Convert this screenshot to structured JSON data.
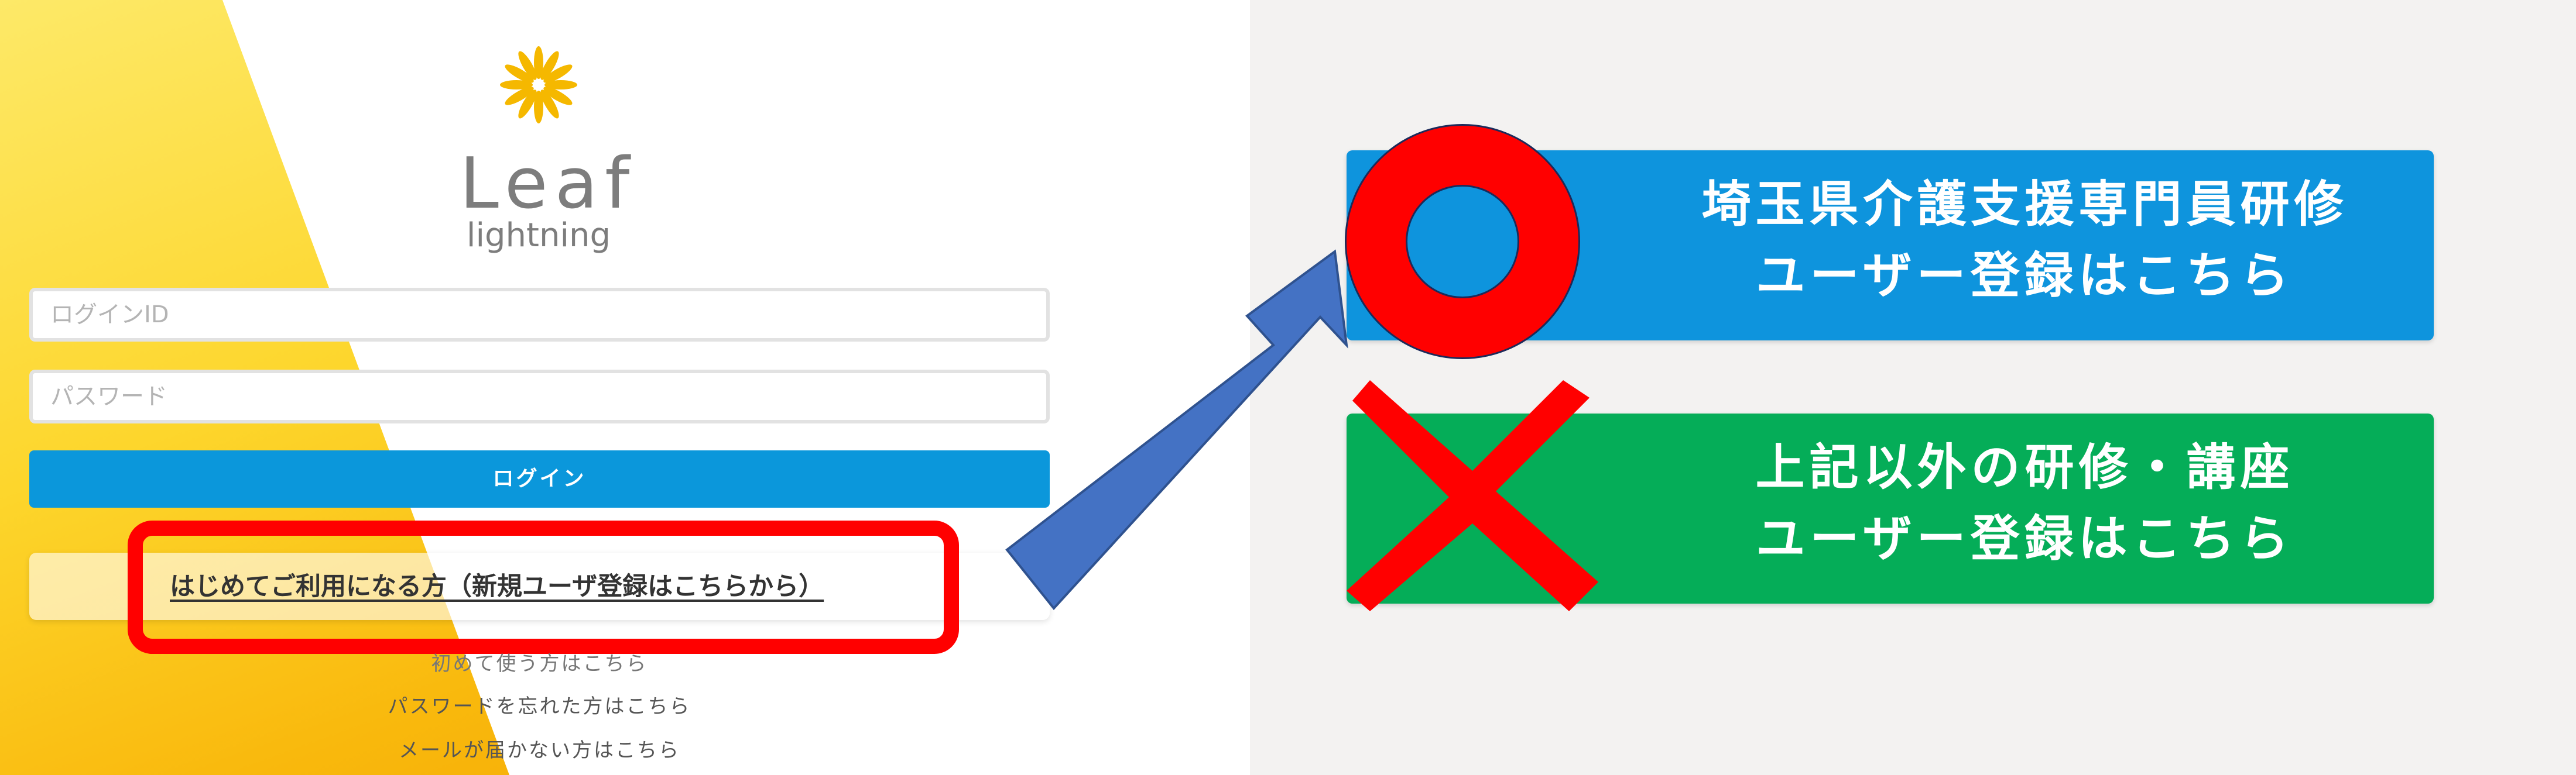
{
  "login": {
    "app_logo": {
      "name": "Leaf",
      "subtitle": "lightning",
      "brand_color": "#f5b800"
    },
    "login_id": {
      "placeholder": "ログインID",
      "value": ""
    },
    "password": {
      "placeholder": "パスワード",
      "value": ""
    },
    "login_button": "ログイン",
    "register_link": "はじめてご利用になる方（新規ユーザ登録はこちらから）",
    "help_links": {
      "first_time": "初めて使う方はこちら",
      "forgot_password": "パスワードを忘れた方はこちら",
      "mail_not_received": "メールが届かない方はこちら"
    }
  },
  "options": [
    {
      "line1": "埼玉県介護支援専門員研修",
      "line2": "ユーザー登録はこちら",
      "color": "#0e94dd",
      "mark": "circle-correct"
    },
    {
      "line1": "上記以外の研修・講座",
      "line2": "ユーザー登録はこちら",
      "color": "#05ad58",
      "mark": "cross-incorrect"
    }
  ],
  "annotation": {
    "highlight_color": "#ff0000",
    "arrow_color": "#4472c4"
  }
}
